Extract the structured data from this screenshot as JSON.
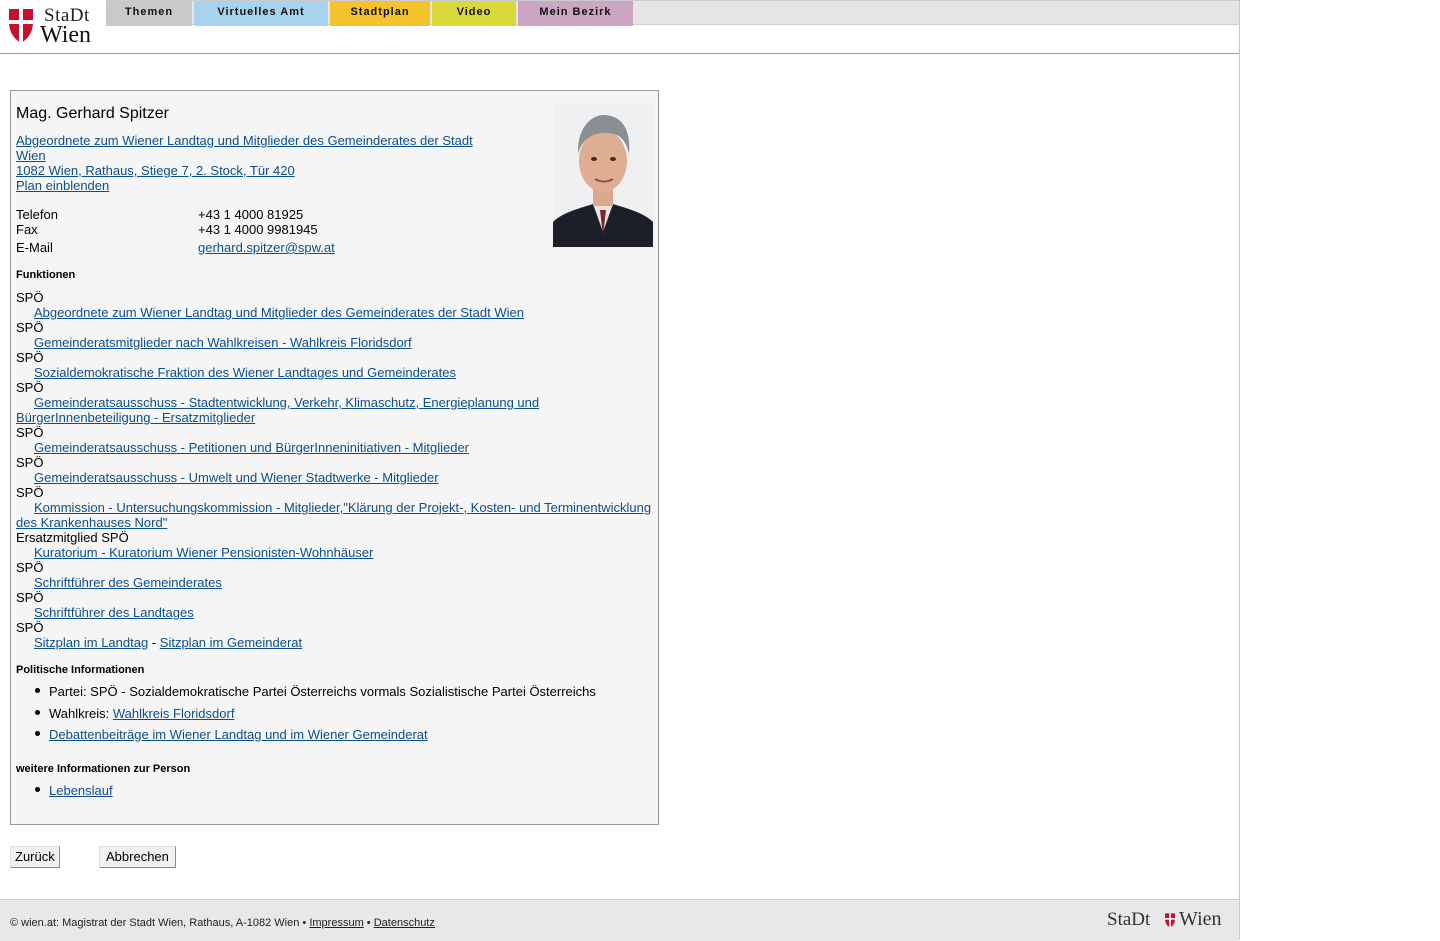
{
  "header": {
    "logo": {
      "line1": "StaDt",
      "line2": "Wien"
    },
    "tabs": [
      {
        "label": "Themen",
        "color": "#c9c9c9"
      },
      {
        "label": "Virtuelles Amt",
        "color": "#a8d3ee"
      },
      {
        "label": "Stadtplan",
        "color": "#f4c22a"
      },
      {
        "label": "Video",
        "color": "#d8d83a"
      },
      {
        "label": "Mein Bezirk",
        "color": "#cba6c2"
      }
    ]
  },
  "person": {
    "name": "Mag. Gerhard Spitzer",
    "role_link_line1": "Abgeordnete zum Wiener Landtag und Mitglieder des Gemeinderates der Stadt",
    "role_link_line2": "Wien",
    "address": "1082 Wien, Rathaus, Stiege 7, 2. Stock, Tür 420",
    "plan_link": "Plan einblenden",
    "photo_icon": "portrait-photo",
    "contact": {
      "phone_label": "Telefon",
      "phone": "+43 1 4000 81925",
      "fax_label": "Fax",
      "fax": "+43 1 4000 9981945",
      "email_label": "E-Mail",
      "email": "gerhard.spitzer@spw.at"
    }
  },
  "functions": {
    "heading": "Funktionen",
    "items": [
      {
        "party": "SPÖ",
        "link": "Abgeordnete zum Wiener Landtag und Mitglieder des Gemeinderates der Stadt Wien"
      },
      {
        "party": "SPÖ",
        "link": "Gemeinderatsmitglieder nach Wahlkreisen - Wahlkreis Floridsdorf"
      },
      {
        "party": "SPÖ",
        "link": "Sozialdemokratische Fraktion des Wiener Landtages und Gemeinderates"
      },
      {
        "party": "SPÖ",
        "link": "Gemeinderatsausschuss - Stadtentwicklung, Verkehr, Klimaschutz, Energieplanung und",
        "link2": "BürgerInnenbeteiligung - Ersatzmitglieder"
      },
      {
        "party": "SPÖ",
        "link": "Gemeinderatsausschuss - Petitionen und BürgerInneninitiativen - Mitglieder"
      },
      {
        "party": "SPÖ",
        "link": "Gemeinderatsausschuss - Umwelt und Wiener Stadtwerke - Mitglieder"
      },
      {
        "party": "SPÖ",
        "link": "Kommission - Untersuchungskommission - Mitglieder,\"Klärung der Projekt-, Kosten- und Terminentwicklung",
        "link2": "des Krankenhauses Nord\""
      },
      {
        "party": "Ersatzmitglied SPÖ",
        "link": "Kuratorium - Kuratorium Wiener Pensionisten-Wohnhäuser"
      },
      {
        "party": "SPÖ",
        "link": "Schriftführer des Gemeinderates"
      },
      {
        "party": "SPÖ",
        "link": "Schriftführer des Landtages"
      },
      {
        "party": "SPÖ",
        "link": "Sitzplan im Landtag",
        "sep": "-",
        "link_b": "Sitzplan im Gemeinderat"
      }
    ]
  },
  "political": {
    "heading": "Politische Informationen",
    "party_text": "Partei: SPÖ - Sozialdemokratische Partei Österreichs vormals Sozialistische Partei Österreichs",
    "district_label": "Wahlkreis:",
    "district_link": "Wahlkreis Floridsdorf",
    "debates_link": "Debattenbeiträge im Wiener Landtag und im Wiener Gemeinderat"
  },
  "further": {
    "heading": "weitere Informationen zur Person",
    "cv_link": "Lebenslauf"
  },
  "buttons": {
    "back": "Zurück",
    "cancel": "Abbrechen"
  },
  "footer": {
    "copyright": "© wien.at: Magistrat der Stadt Wien, Rathaus, A-1082 Wien •",
    "impressum": "Impressum",
    "dot": "•",
    "datenschutz": "Datenschutz",
    "logo_left": "StaDt",
    "logo_right": "Wien"
  }
}
